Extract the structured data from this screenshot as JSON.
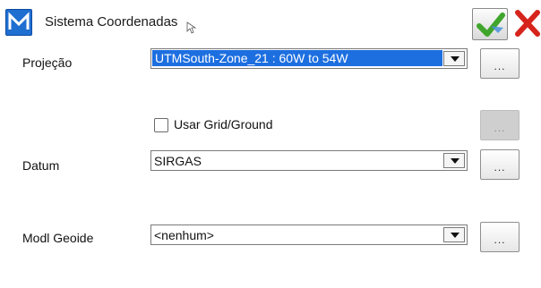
{
  "window": {
    "title": "Sistema Coordenadas",
    "ok_icon": "check-icon",
    "close_icon": "close-icon"
  },
  "projecao": {
    "label": "Projeção",
    "value": "UTMSouth-Zone_21 : 60W to 54W",
    "ellipsis": "..."
  },
  "grid_ground": {
    "label": "Usar Grid/Ground",
    "checked": false,
    "ellipsis": "..."
  },
  "datum": {
    "label": "Datum",
    "value": "SIRGAS",
    "ellipsis": "..."
  },
  "geoide": {
    "label": "Modl Geoide",
    "value": "<nenhum>",
    "ellipsis": "..."
  },
  "colors": {
    "selection": "#1d6fe0",
    "ok_check": "#3fa52b",
    "close_x": "#d6241c",
    "logo": "#1f6fd1"
  }
}
